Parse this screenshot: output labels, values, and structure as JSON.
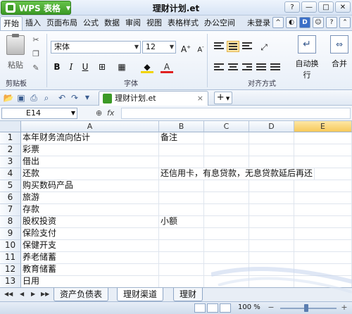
{
  "app": {
    "brand_label": "WPS 表格",
    "title": "理财计划.et",
    "win_buttons": [
      "?",
      "—",
      "□",
      "✕"
    ]
  },
  "ribbon_tabs": [
    "开始",
    "插入",
    "页面布局",
    "公式",
    "数据",
    "审阅",
    "视图",
    "表格样式",
    "办公空间"
  ],
  "account": {
    "login_label": "未登录"
  },
  "ribbon": {
    "clipboard": {
      "paste_label": "粘贴",
      "group_label": "剪贴板"
    },
    "font": {
      "family": "宋体",
      "size": "12",
      "group_label": "字体",
      "bold": "B",
      "italic": "I",
      "underline": "U"
    },
    "alignment": {
      "group_label": "对齐方式",
      "wrap_label": "自动换行",
      "merge_label": "合并"
    }
  },
  "toolbar": {
    "doc_tab_label": "理财计划.et",
    "new_tab": "+"
  },
  "formula_bar": {
    "cell_ref": "E14",
    "fx_label": "fx",
    "value": ""
  },
  "grid": {
    "columns": [
      "A",
      "B",
      "C",
      "D",
      "E"
    ],
    "selected_column": "E",
    "selected_row": "14",
    "rows": [
      {
        "num": "1",
        "A": "本年财务流向估计",
        "B": "备注"
      },
      {
        "num": "2",
        "A": "彩票",
        "B": ""
      },
      {
        "num": "3",
        "A": "借出",
        "B": ""
      },
      {
        "num": "4",
        "A": "还款",
        "B": "还信用卡，有息贷款，无息贷款延后再还"
      },
      {
        "num": "5",
        "A": "购买数码产品",
        "B": ""
      },
      {
        "num": "6",
        "A": "旅游",
        "B": ""
      },
      {
        "num": "7",
        "A": "存款",
        "B": ""
      },
      {
        "num": "8",
        "A": "股权投资",
        "B": "小额"
      },
      {
        "num": "9",
        "A": "保险支付",
        "B": ""
      },
      {
        "num": "10",
        "A": "保健开支",
        "B": ""
      },
      {
        "num": "11",
        "A": "养老储蓄",
        "B": ""
      },
      {
        "num": "12",
        "A": "教育储蓄",
        "B": ""
      },
      {
        "num": "13",
        "A": "日用",
        "B": ""
      }
    ]
  },
  "sheets": {
    "tabs": [
      "资产负债表",
      "理财渠道",
      "理财"
    ],
    "active": "理财渠道"
  },
  "status": {
    "zoom": "100 %"
  }
}
